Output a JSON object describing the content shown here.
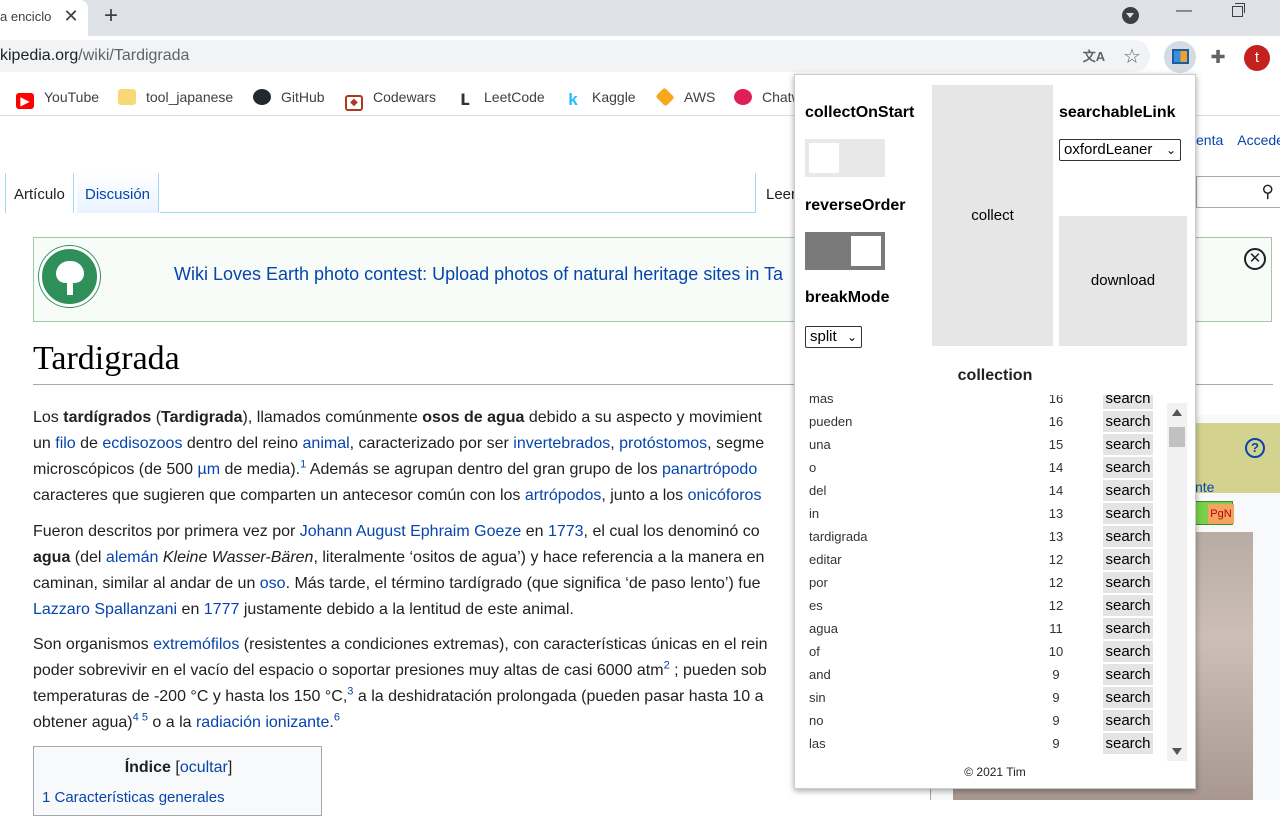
{
  "browser": {
    "tab_title": "a enciclo",
    "url_host": "kipedia.org",
    "url_path": "/wiki/Tardigrada",
    "bookmarks": [
      "YouTube",
      "tool_japanese",
      "GitHub",
      "Codewars",
      "LeetCode",
      "Kaggle",
      "AWS",
      "Chatw"
    ],
    "profile_initial": "t"
  },
  "wiki": {
    "tab_article": "Artículo",
    "tab_discussion": "Discusión",
    "tab_read": "Leer",
    "right_link_1": "enta",
    "right_link_2": "Acceder",
    "banner_text": "Wiki Loves Earth photo contest: Upload photos of natural heritage sites in Ta",
    "page_title": "Tardigrada",
    "toc_title": "Índice",
    "toc_toggle": "ocultar",
    "toc_item_1": "1  Características generales",
    "infobox_link": "nte",
    "infobox_badge": "PgN"
  },
  "extension": {
    "collect_on_start_label": "collectOnStart",
    "collect_on_start": false,
    "reverse_order_label": "reverseOrder",
    "reverse_order": true,
    "break_mode_label": "breakMode",
    "break_mode_value": "split",
    "searchable_link_label": "searchableLink",
    "searchable_link_value": "oxfordLeaner",
    "collect_label": "collect",
    "download_label": "download",
    "collection_title": "collection",
    "search_label": "search",
    "footer": "© 2021 Tim",
    "collection": [
      {
        "word": "más",
        "count": "16"
      },
      {
        "word": "pueden",
        "count": "16"
      },
      {
        "word": "una",
        "count": "15"
      },
      {
        "word": "o",
        "count": "14"
      },
      {
        "word": "del",
        "count": "14"
      },
      {
        "word": "in",
        "count": "13"
      },
      {
        "word": "tardigrada",
        "count": "13"
      },
      {
        "word": "editar",
        "count": "12"
      },
      {
        "word": "por",
        "count": "12"
      },
      {
        "word": "es",
        "count": "12"
      },
      {
        "word": "agua",
        "count": "11"
      },
      {
        "word": "of",
        "count": "10"
      },
      {
        "word": "and",
        "count": "9"
      },
      {
        "word": "sin",
        "count": "9"
      },
      {
        "word": "no",
        "count": "9"
      },
      {
        "word": "las",
        "count": "9"
      }
    ]
  }
}
